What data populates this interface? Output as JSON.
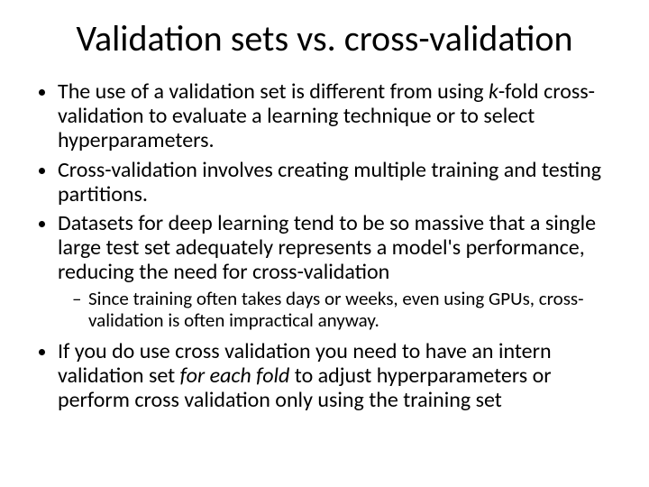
{
  "title": "Validation sets vs. cross-validation",
  "bullets": {
    "b1a": "The use of a validation set is different from using ",
    "b1k": "k",
    "b1b": "-fold cross-validation to evaluate a learning technique or to select hyperparameters.",
    "b2": "Cross-validation involves creating multiple training and testing partitions.",
    "b3": "Datasets for deep learning tend to be so massive that a single large test set adequately represents a model's performance, reducing the need for cross-validation",
    "b3s1": "Since training often takes days or weeks, even using GPUs, cross-validation is often impractical anyway.",
    "b4a": "If you do use cross validation you need to have an intern validation set ",
    "b4i": "for each fold",
    "b4b": " to adjust hyperparameters or perform cross validation only using the training set"
  }
}
